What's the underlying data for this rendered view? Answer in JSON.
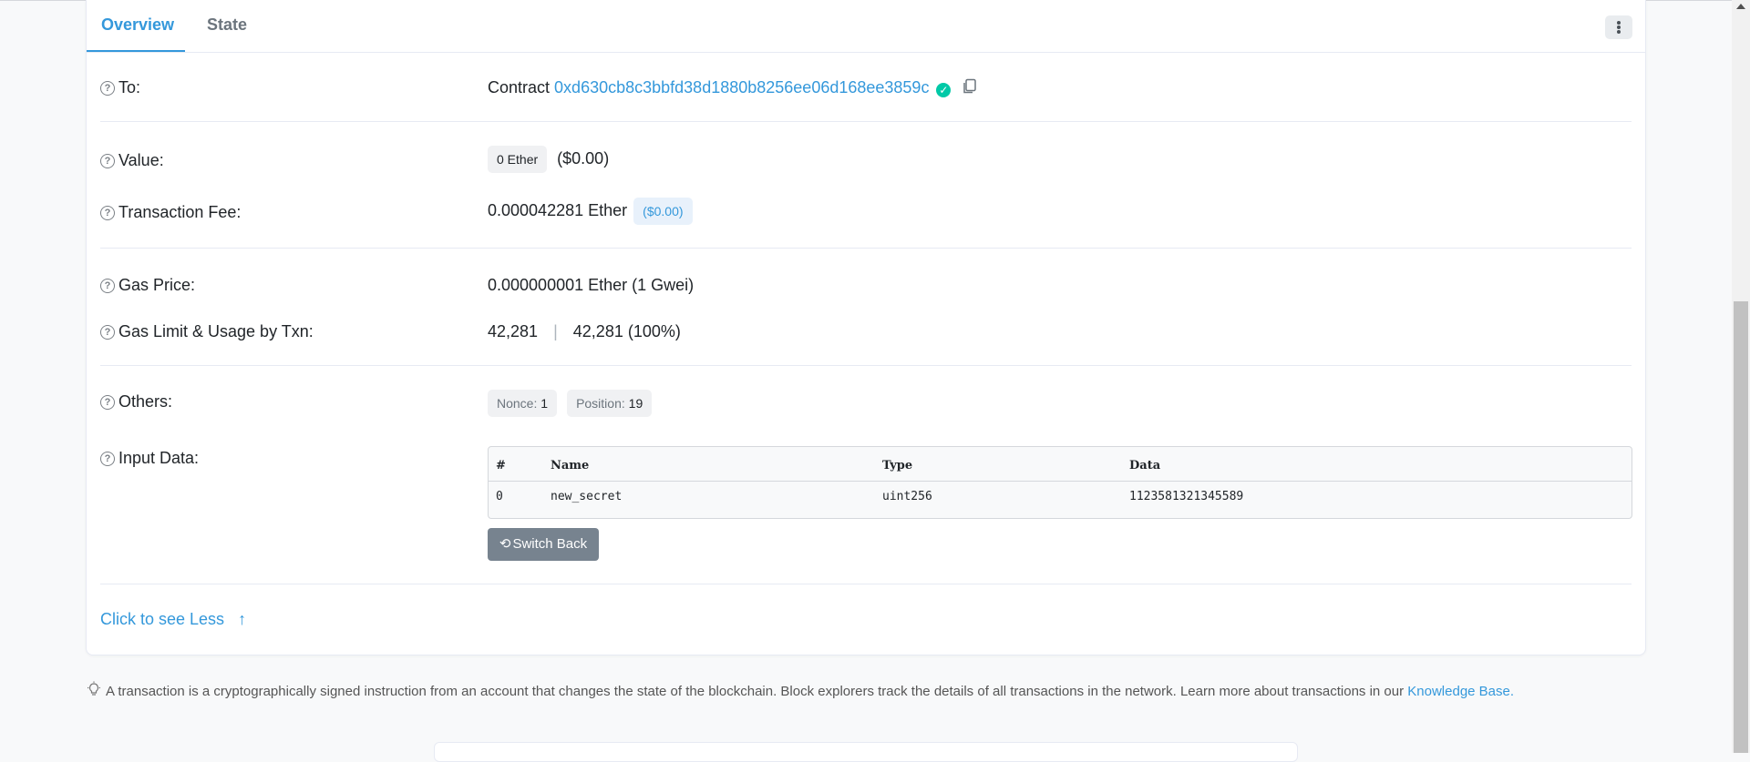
{
  "tabs": [
    {
      "label": "Overview"
    },
    {
      "label": "State"
    }
  ],
  "rows": {
    "to": {
      "label": "To:",
      "prefix": "Contract",
      "address": "0xd630cb8c3bbfd38d1880b8256ee06d168ee3859c"
    },
    "value": {
      "label": "Value:",
      "badge": "0 Ether",
      "usd": "($0.00)"
    },
    "fee": {
      "label": "Transaction Fee:",
      "amount": "0.000042281 Ether",
      "usd": "($0.00)"
    },
    "gas_price": {
      "label": "Gas Price:",
      "value": "0.000000001 Ether (1 Gwei)"
    },
    "gas_limit": {
      "label": "Gas Limit & Usage by Txn:",
      "limit": "42,281",
      "divider": "|",
      "usage": "42,281 (100%)"
    },
    "others": {
      "label": "Others:",
      "nonce_label": "Nonce:",
      "nonce": "1",
      "position_label": "Position:",
      "position": "19"
    },
    "input": {
      "label": "Input Data:"
    }
  },
  "input_table": {
    "headers": [
      "#",
      "Name",
      "Type",
      "Data"
    ],
    "rows": [
      [
        "0",
        "new_secret",
        "uint256",
        "1123581321345589"
      ]
    ]
  },
  "switch_back_label": "Switch Back",
  "see_less_label": "Click to see Less",
  "footer": {
    "text": "A transaction is a cryptographically signed instruction from an account that changes the state of the blockchain. Block explorers track the details of all transactions in the network. Learn more about transactions in our",
    "link": "Knowledge Base."
  },
  "icons": {
    "help": "question-circle-icon",
    "verified": "check-circle-icon",
    "copy": "copy-icon",
    "arrow_up": "arrow-up-icon",
    "undo": "undo-icon",
    "bulb": "lightbulb-icon",
    "kebab": "more-vertical-icon"
  },
  "colors": {
    "accent": "#3498db",
    "verified": "#00c9a7",
    "button": "#77838f"
  }
}
